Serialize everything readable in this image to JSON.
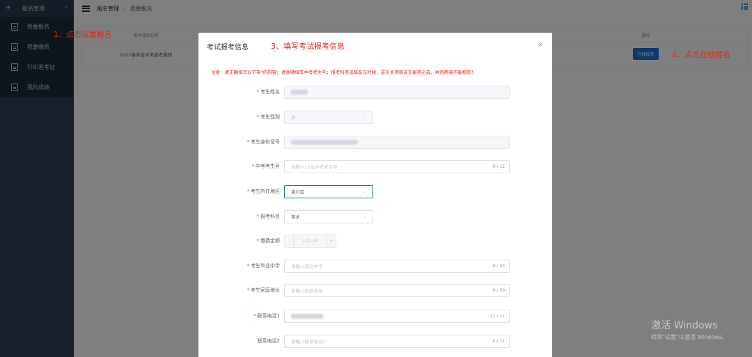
{
  "sidebar": {
    "header": "报名管理",
    "items": [
      {
        "label": "我要报名"
      },
      {
        "label": "我要缴费"
      },
      {
        "label": "打印准考证"
      },
      {
        "label": "我的成绩"
      }
    ]
  },
  "topbar": {
    "breadcrumb_root": "报名管理",
    "breadcrumb_sep": "/",
    "breadcrumb_current": "我要报名"
  },
  "table": {
    "headers": [
      "报考通知名称",
      "",
      "",
      "",
      "",
      "操作"
    ],
    "row": {
      "name": "2022春季音体美报考通知",
      "action": "在线报名"
    }
  },
  "annotations": {
    "step1": "1、点击我要报名",
    "step2": "2、点击在线报名",
    "step3": "3、填写考试报考信息"
  },
  "dialog": {
    "title": "考试报考信息",
    "close": "×",
    "notice": "注意：请正确填写以下带*的内容；请准确填写中考考生号；报考科目选择音乐时候，音乐主项和音乐副项必选，并且两者不能相同！",
    "fields": {
      "name": {
        "label": "考生姓名"
      },
      "gender": {
        "label": "考生性别",
        "value": "男"
      },
      "idcard": {
        "label": "考生身份证号"
      },
      "exam_no": {
        "label": "中考考生号",
        "placeholder": "请输入12位中考考生号",
        "count": "0 / 12"
      },
      "region": {
        "label": "考生所在地区",
        "value": "袁川区"
      },
      "subject": {
        "label": "报考科目",
        "value": "美术"
      },
      "fee": {
        "label": "缴费金额",
        "value": "120.00",
        "minus": "-",
        "plus": "+"
      },
      "school": {
        "label": "考生毕业中学",
        "placeholder": "请输入毕业中学",
        "count": "0 / 50"
      },
      "address": {
        "label": "考生家庭地址",
        "placeholder": "请输入家庭地址",
        "count": "0 / 50"
      },
      "phone1": {
        "label": "联系电话1",
        "count": "11 / 11"
      },
      "phone2": {
        "label": "联系电话2",
        "placeholder": "请输入联系电话2",
        "count": "0 / 11"
      }
    },
    "required_mark": "*"
  },
  "watermark": {
    "line1": "激活 Windows",
    "line2": "转到\"设置\"以激活 Windows。"
  },
  "colors": {
    "sidebar_bg": "#304156",
    "primary": "#1f6fd1",
    "annotation": "#e5261f"
  }
}
